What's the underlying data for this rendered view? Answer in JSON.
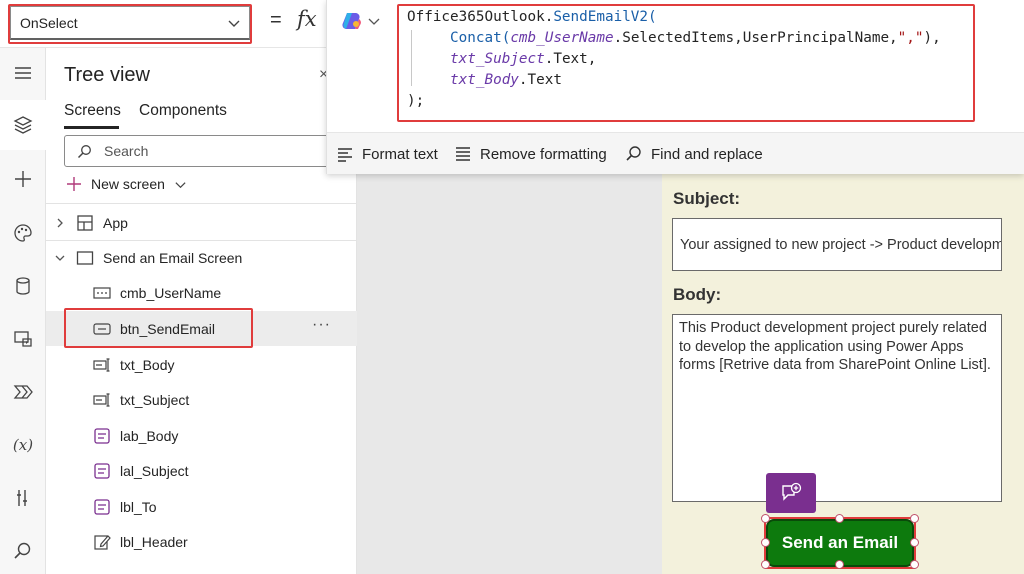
{
  "formula_bar": {
    "property": "OnSelect",
    "equals": "=",
    "fx": "fx",
    "code_lines": {
      "l1_a": "Office365Outlook.",
      "l1_b": "SendEmailV2(",
      "l2_fn": "Concat(",
      "l2_id": "cmb_UserName",
      "l2_rest": ".SelectedItems,UserPrincipalName,",
      "l2_str": "\",\"",
      "l2_end": "),",
      "l3_id": "txt_Subject",
      "l3_rest": ".Text,",
      "l4_id": "txt_Body",
      "l4_rest": ".Text",
      "l5": ");"
    },
    "toolbar": {
      "format_text": "Format text",
      "remove_formatting": "Remove formatting",
      "find_replace": "Find and replace"
    }
  },
  "tree_view": {
    "title": "Tree view",
    "close": "×",
    "tabs": [
      "Screens",
      "Components"
    ],
    "search_placeholder": "Search",
    "new_screen": "New screen",
    "app_label": "App",
    "screen_label": "Send an Email Screen",
    "controls": [
      {
        "name": "cmb_UserName",
        "icon": "combobox-icon"
      },
      {
        "name": "btn_SendEmail",
        "icon": "button-icon"
      },
      {
        "name": "txt_Body",
        "icon": "textinput-icon"
      },
      {
        "name": "txt_Subject",
        "icon": "textinput-icon"
      },
      {
        "name": "lab_Body",
        "icon": "label-icon"
      },
      {
        "name": "lal_Subject",
        "icon": "label-icon"
      },
      {
        "name": "lbl_To",
        "icon": "label-icon"
      },
      {
        "name": "lbl_Header",
        "icon": "edit-label-icon"
      }
    ],
    "more": "···"
  },
  "canvas": {
    "subject_label": "Subject:",
    "subject_value": "Your assigned to new project -> Product development",
    "body_label": "Body:",
    "body_value": "This Product development project purely related to develop the application using Power Apps forms [Retrive data from SharePoint Online List].",
    "send_button": "Send an Email"
  },
  "colors": {
    "highlight_red": "#e03c3c",
    "send_green": "#0d7a0d",
    "comment_purple": "#7a2f8f",
    "app_bg": "#f3f1dc"
  }
}
